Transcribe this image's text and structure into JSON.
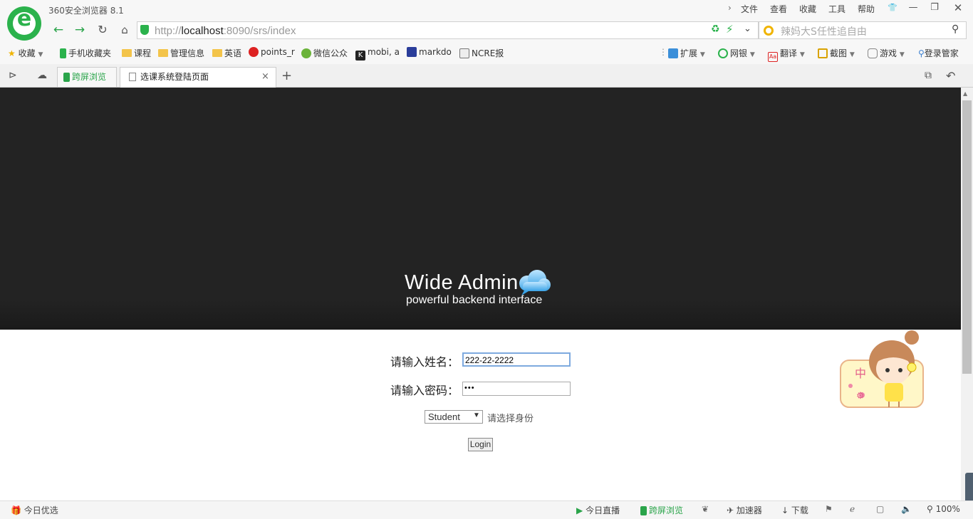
{
  "browser": {
    "title": "360安全浏览器 8.1",
    "menu": [
      "文件",
      "查看",
      "收藏",
      "工具",
      "帮助"
    ],
    "url_scheme": "http://",
    "url_host": "localhost",
    "url_rest": ":8090/srs/index",
    "search_placeholder": "辣妈大S任性追自由"
  },
  "bookmarks": [
    "收藏",
    "手机收藏夹",
    "课程",
    "管理信息",
    "英语",
    "points_r",
    "微信公众",
    "mobi, a",
    "markdo",
    "NCRE报"
  ],
  "toolbar_right": [
    "扩展",
    "网银",
    "翻译",
    "截图",
    "游戏",
    "登录管家"
  ],
  "tabs": {
    "cross": "跨屏浏览",
    "active": "选课系统登陆页面"
  },
  "page": {
    "brand_title": "Wide Admin",
    "brand_subtitle": "powerful backend interface",
    "name_label": "请输入姓名：",
    "name_value": "222-22-2222",
    "password_label": "请输入密码：",
    "password_value": "•••",
    "role_selected": "Student",
    "role_hint": "请选择身份",
    "login_label": "Login"
  },
  "mascot_char": "中",
  "status": {
    "left": "今日优选",
    "live": "今日直播",
    "cross": "跨屏浏览",
    "accel": "加速器",
    "download": "下载",
    "zoom": "100%"
  }
}
